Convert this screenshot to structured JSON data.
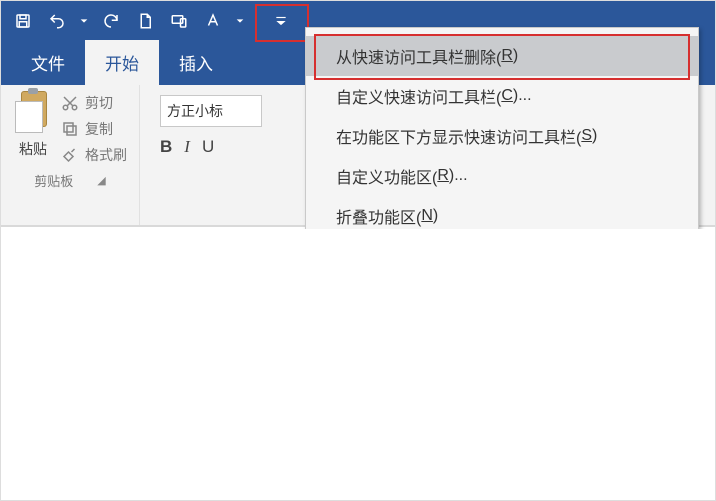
{
  "qat": {
    "icons": [
      "save-icon",
      "undo-icon",
      "redo-icon",
      "new-doc-icon",
      "device-preview-icon",
      "font-color-icon",
      "customize-qat-icon"
    ]
  },
  "tabs": {
    "file": "文件",
    "home": "开始",
    "insert": "插入"
  },
  "clipboard_group": {
    "paste": "粘贴",
    "cut": "剪切",
    "copy": "复制",
    "format_painter": "格式刷",
    "label": "剪贴板"
  },
  "font_group": {
    "font_name": "方正小标",
    "bold": "B",
    "italic": "I",
    "underline_trunc": "U"
  },
  "context_menu": {
    "remove_from_qat": "从快速访问工具栏删除(",
    "remove_from_qat_key": "R",
    "remove_from_qat_tail": ")",
    "customize_qat": "自定义快速访问工具栏(",
    "customize_qat_key": "C",
    "customize_qat_tail": ")...",
    "show_below_ribbon": "在功能区下方显示快速访问工具栏(",
    "show_below_ribbon_key": "S",
    "show_below_ribbon_tail": ")",
    "customize_ribbon": "自定义功能区(",
    "customize_ribbon_key": "R",
    "customize_ribbon_tail": ")...",
    "collapse_ribbon": "折叠功能区(",
    "collapse_ribbon_key": "N",
    "collapse_ribbon_tail": ")"
  }
}
